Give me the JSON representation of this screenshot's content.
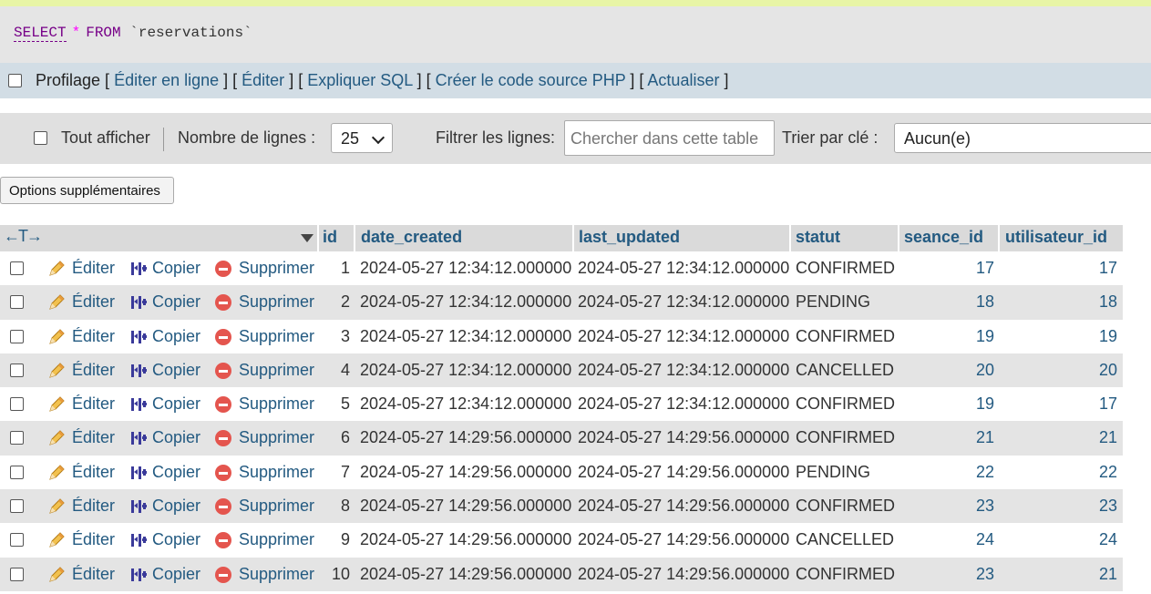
{
  "sql": {
    "select": "SELECT",
    "star": "*",
    "from": "FROM",
    "table": "`reservations`"
  },
  "links": {
    "profiling": "Profilage",
    "edit_inline": "Éditer en ligne",
    "edit": "Éditer",
    "explain": "Expliquer SQL",
    "php": "Créer le code source PHP",
    "refresh": "Actualiser"
  },
  "nav": {
    "show_all": "Tout afficher",
    "rows_label": "Nombre de lignes :",
    "rows_value": "25",
    "filter_label": "Filtrer les lignes:",
    "filter_placeholder": "Chercher dans cette table",
    "sort_label": "Trier par clé :",
    "sort_value": "Aucun(e)"
  },
  "options_button": "Options supplémentaires",
  "table": {
    "arrows": "←T→",
    "headers": [
      "id",
      "date_created",
      "last_updated",
      "statut",
      "seance_id",
      "utilisateur_id"
    ],
    "actions": {
      "edit": "Éditer",
      "copy": "Copier",
      "delete": "Supprimer"
    },
    "rows": [
      {
        "id": "1",
        "date_created": "2024-05-27 12:34:12.000000",
        "last_updated": "2024-05-27 12:34:12.000000",
        "statut": "CONFIRMED",
        "seance_id": "17",
        "utilisateur_id": "17"
      },
      {
        "id": "2",
        "date_created": "2024-05-27 12:34:12.000000",
        "last_updated": "2024-05-27 12:34:12.000000",
        "statut": "PENDING",
        "seance_id": "18",
        "utilisateur_id": "18"
      },
      {
        "id": "3",
        "date_created": "2024-05-27 12:34:12.000000",
        "last_updated": "2024-05-27 12:34:12.000000",
        "statut": "CONFIRMED",
        "seance_id": "19",
        "utilisateur_id": "19"
      },
      {
        "id": "4",
        "date_created": "2024-05-27 12:34:12.000000",
        "last_updated": "2024-05-27 12:34:12.000000",
        "statut": "CANCELLED",
        "seance_id": "20",
        "utilisateur_id": "20"
      },
      {
        "id": "5",
        "date_created": "2024-05-27 12:34:12.000000",
        "last_updated": "2024-05-27 12:34:12.000000",
        "statut": "CONFIRMED",
        "seance_id": "19",
        "utilisateur_id": "17"
      },
      {
        "id": "6",
        "date_created": "2024-05-27 14:29:56.000000",
        "last_updated": "2024-05-27 14:29:56.000000",
        "statut": "CONFIRMED",
        "seance_id": "21",
        "utilisateur_id": "21"
      },
      {
        "id": "7",
        "date_created": "2024-05-27 14:29:56.000000",
        "last_updated": "2024-05-27 14:29:56.000000",
        "statut": "PENDING",
        "seance_id": "22",
        "utilisateur_id": "22"
      },
      {
        "id": "8",
        "date_created": "2024-05-27 14:29:56.000000",
        "last_updated": "2024-05-27 14:29:56.000000",
        "statut": "CONFIRMED",
        "seance_id": "23",
        "utilisateur_id": "23"
      },
      {
        "id": "9",
        "date_created": "2024-05-27 14:29:56.000000",
        "last_updated": "2024-05-27 14:29:56.000000",
        "statut": "CANCELLED",
        "seance_id": "24",
        "utilisateur_id": "24"
      },
      {
        "id": "10",
        "date_created": "2024-05-27 14:29:56.000000",
        "last_updated": "2024-05-27 14:29:56.000000",
        "statut": "CONFIRMED",
        "seance_id": "23",
        "utilisateur_id": "21"
      }
    ]
  },
  "colors": {
    "link": "#235a81",
    "keyword": "#770088",
    "delete_icon": "#e4554e"
  },
  "icons": {
    "edit": "pencil-icon",
    "copy": "copy-icon",
    "delete": "delete-icon",
    "sort": "sort-desc-icon",
    "dropdown": "chevron-down-icon"
  }
}
